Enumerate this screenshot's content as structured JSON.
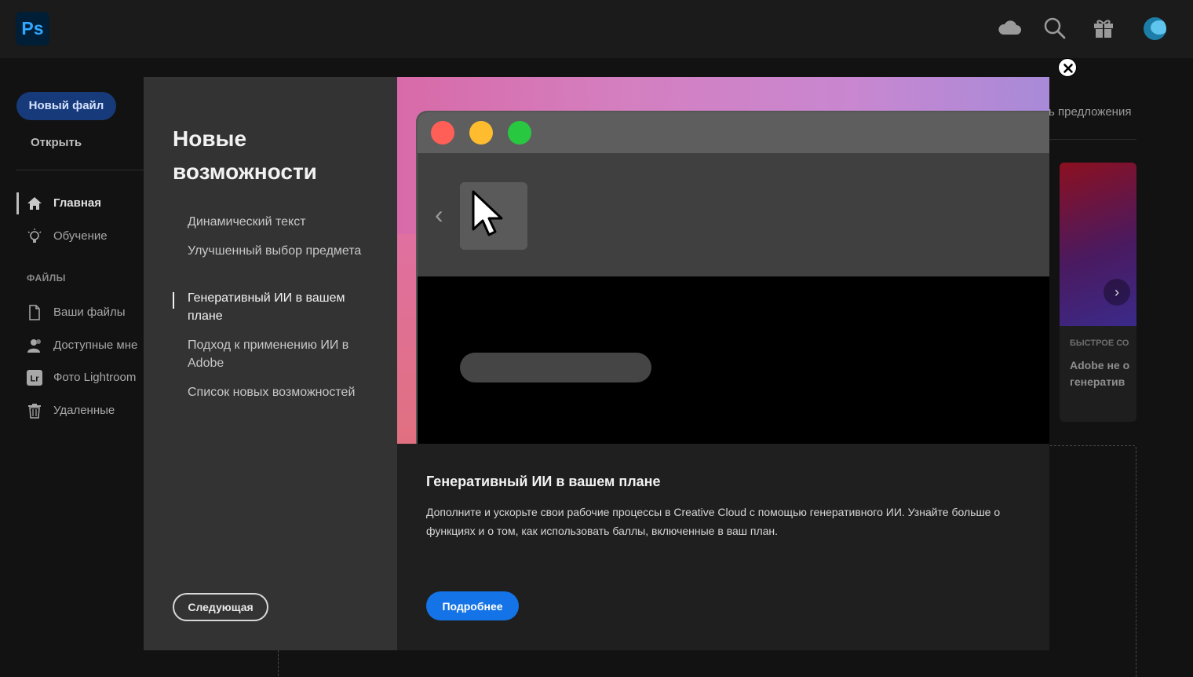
{
  "app": {
    "logo_text": "Ps",
    "colors": {
      "accent": "#1473e6",
      "logo_bg": "#001e36",
      "logo_fg": "#31a8ff"
    }
  },
  "topbar": {
    "icons": [
      "cloud-icon",
      "search-icon",
      "gift-icon",
      "avatar"
    ]
  },
  "sidebar": {
    "new_file": "Новый файл",
    "open": "Открыть",
    "nav": [
      {
        "label": "Главная",
        "icon": "home-icon",
        "active": true
      },
      {
        "label": "Обучение",
        "icon": "lightbulb-icon",
        "active": false
      }
    ],
    "files_section": "ФАЙЛЫ",
    "files": [
      {
        "label": "Ваши файлы",
        "icon": "file-icon"
      },
      {
        "label": "Доступные мне",
        "icon": "shared-user-icon"
      },
      {
        "label": "Фото Lightroom",
        "icon": "lightroom-icon"
      },
      {
        "label": "Удаленные",
        "icon": "trash-icon"
      }
    ],
    "lightroom_badge": "Lr"
  },
  "background": {
    "offers_text": "ь предложения",
    "card_category": "БЫСТРОЕ СО",
    "card_title": "Adobe не о генератив"
  },
  "modal": {
    "title": "Новые возможности",
    "toc": [
      {
        "label": "Динамический текст",
        "active": false
      },
      {
        "label": "Улучшенный выбор предмета",
        "active": false
      },
      {
        "label": "Генеративный ИИ в вашем плане",
        "active": true
      },
      {
        "label": "Подход к применению ИИ в Adobe",
        "active": false
      },
      {
        "label": "Список новых возможностей",
        "active": false
      }
    ],
    "next_button": "Следующая",
    "content": {
      "title": "Генеративный ИИ в вашем плане",
      "description": "Дополните и ускорьте свои рабочие процессы в Creative Cloud с помощью генеративного ИИ. Узнайте больше о функциях и о том, как использовать баллы, включенные в ваш план.",
      "more_button": "Подробнее"
    },
    "hero": {
      "dot_colors": [
        "#ff5f57",
        "#febc2e",
        "#28c840"
      ]
    }
  }
}
